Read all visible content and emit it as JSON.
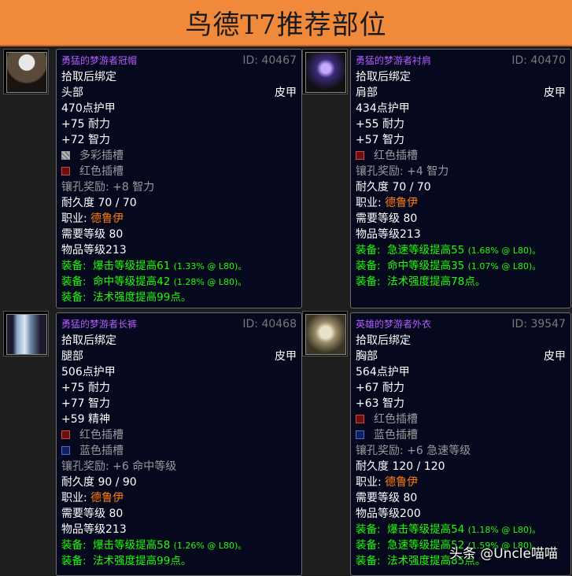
{
  "banner": {
    "title": "鸟德T7推荐部位"
  },
  "items": [
    {
      "icon": "helm-icon",
      "name": "勇猛的梦游者冠帽",
      "id": "ID: 40467",
      "bind": "拾取后绑定",
      "slot": "头部",
      "armor_type": "皮甲",
      "armor": "470点护甲",
      "stats": [
        "+75 耐力",
        "+72 智力"
      ],
      "sockets": [
        {
          "color": "meta",
          "label": "多彩插槽"
        },
        {
          "color": "red",
          "label": "红色插槽"
        }
      ],
      "socket_bonus": "镶孔奖励: +8 智力",
      "durability": "耐久度 70 / 70",
      "class_label": "职业: ",
      "class_name": "德鲁伊",
      "req_level": "需要等级 80",
      "item_level": "物品等级213",
      "equips": [
        {
          "label": "装备:",
          "text": "爆击等级提高61",
          "pct": "(1.33% @ L80)。"
        },
        {
          "label": "装备:",
          "text": "命中等级提高42",
          "pct": "(1.28% @ L80)。"
        },
        {
          "label": "装备:",
          "text": "法术强度提高99点。",
          "pct": ""
        }
      ]
    },
    {
      "icon": "shoulder-icon",
      "name": "勇猛的梦游者衬肩",
      "id": "ID: 40470",
      "bind": "拾取后绑定",
      "slot": "肩部",
      "armor_type": "皮甲",
      "armor": "434点护甲",
      "stats": [
        "+55 耐力",
        "+57 智力"
      ],
      "sockets": [
        {
          "color": "red",
          "label": "红色插槽"
        }
      ],
      "socket_bonus": "镶孔奖励: +4 智力",
      "durability": "耐久度 70 / 70",
      "class_label": "职业: ",
      "class_name": "德鲁伊",
      "req_level": "需要等级 80",
      "item_level": "物品等级213",
      "equips": [
        {
          "label": "装备:",
          "text": "急速等级提高55",
          "pct": "(1.68% @ L80)。"
        },
        {
          "label": "装备:",
          "text": "命中等级提高35",
          "pct": "(1.07% @ L80)。"
        },
        {
          "label": "装备:",
          "text": "法术强度提高78点。",
          "pct": ""
        }
      ]
    },
    {
      "icon": "legs-icon",
      "name": "勇猛的梦游者长裤",
      "id": "ID: 40468",
      "bind": "拾取后绑定",
      "slot": "腿部",
      "armor_type": "皮甲",
      "armor": "506点护甲",
      "stats": [
        "+75 耐力",
        "+77 智力",
        "+59 精神"
      ],
      "sockets": [
        {
          "color": "red",
          "label": "红色插槽"
        },
        {
          "color": "blue",
          "label": "蓝色插槽"
        }
      ],
      "socket_bonus": "镶孔奖励: +6 命中等级",
      "durability": "耐久度 90 / 90",
      "class_label": "职业: ",
      "class_name": "德鲁伊",
      "req_level": "需要等级 80",
      "item_level": "物品等级213",
      "equips": [
        {
          "label": "装备:",
          "text": "爆击等级提高58",
          "pct": "(1.26% @ L80)。"
        },
        {
          "label": "装备:",
          "text": "法术强度提高99点。",
          "pct": ""
        }
      ]
    },
    {
      "icon": "chest-icon",
      "name": "英雄的梦游者外衣",
      "id": "ID: 39547",
      "bind": "拾取后绑定",
      "slot": "胸部",
      "armor_type": "皮甲",
      "armor": "564点护甲",
      "stats": [
        "+67 耐力",
        "+63 智力"
      ],
      "sockets": [
        {
          "color": "red",
          "label": "红色插槽"
        },
        {
          "color": "blue",
          "label": "蓝色插槽"
        }
      ],
      "socket_bonus": "镶孔奖励: +6 急速等级",
      "durability": "耐久度 120 / 120",
      "class_label": "职业: ",
      "class_name": "德鲁伊",
      "req_level": "需要等级 80",
      "item_level": "物品等级200",
      "equips": [
        {
          "label": "装备:",
          "text": "爆击等级提高54",
          "pct": "(1.18% @ L80)。"
        },
        {
          "label": "装备:",
          "text": "急速等级提高52",
          "pct": "(1.59% @ L80)。"
        },
        {
          "label": "装备:",
          "text": "法术强度提高85点。",
          "pct": ""
        }
      ]
    }
  ],
  "watermark": "头条 @Uncle喵喵"
}
